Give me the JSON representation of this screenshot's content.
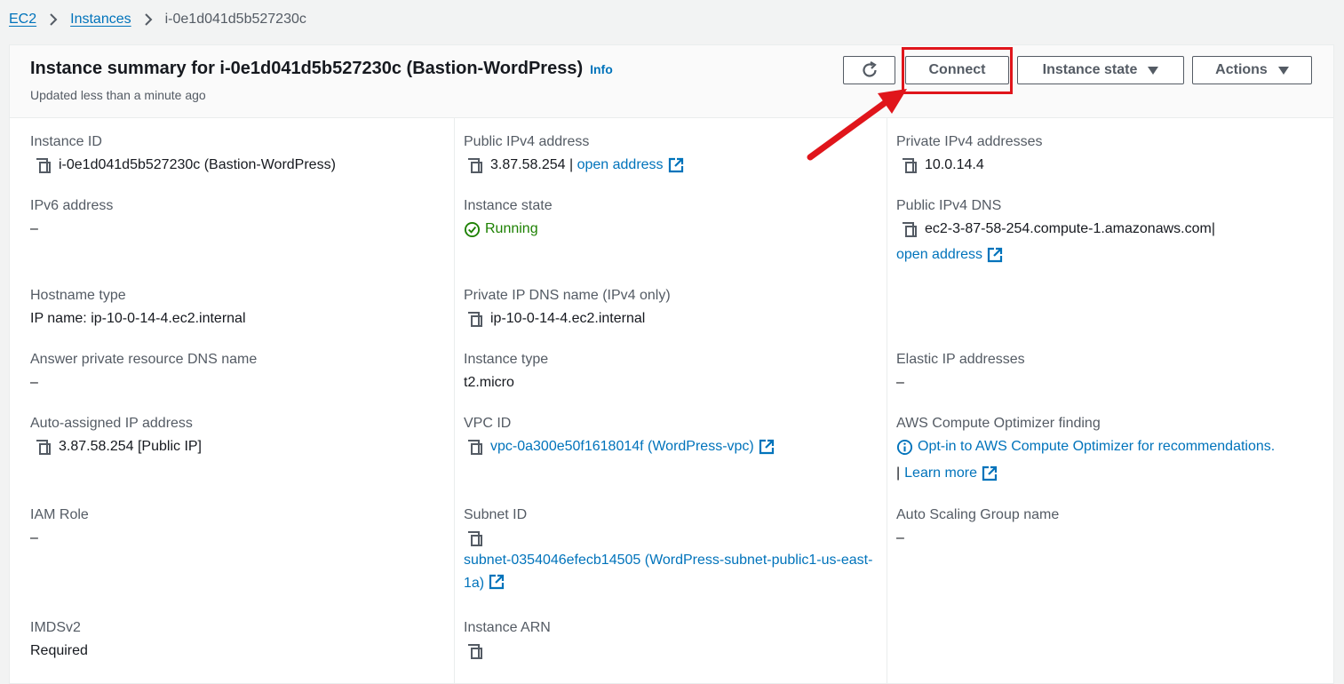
{
  "breadcrumb": {
    "root": "EC2",
    "parent": "Instances",
    "current": "i-0e1d041d5b527230c"
  },
  "header": {
    "title": "Instance summary for i-0e1d041d5b527230c (Bastion-WordPress)",
    "info": "Info",
    "subtitle": "Updated less than a minute ago",
    "connect": "Connect",
    "instance_state": "Instance state",
    "actions": "Actions"
  },
  "fields": {
    "instance_id": {
      "label": "Instance ID",
      "value": "i-0e1d041d5b527230c (Bastion-WordPress)"
    },
    "public_ipv4": {
      "label": "Public IPv4 address",
      "value": "3.87.58.254 |",
      "link": "open address"
    },
    "private_ipv4": {
      "label": "Private IPv4 addresses",
      "value": "10.0.14.4"
    },
    "ipv6": {
      "label": "IPv6 address",
      "value": "–"
    },
    "instance_state": {
      "label": "Instance state",
      "value": "Running"
    },
    "public_dns": {
      "label": "Public IPv4 DNS",
      "value": "ec2-3-87-58-254.compute-1.amazonaws.com|",
      "link": "open address"
    },
    "hostname_type": {
      "label": "Hostname type",
      "value": "IP name: ip-10-0-14-4.ec2.internal"
    },
    "private_dns": {
      "label": "Private IP DNS name (IPv4 only)",
      "value": "ip-10-0-14-4.ec2.internal"
    },
    "answer_dns": {
      "label": "Answer private resource DNS name",
      "value": "–"
    },
    "instance_type": {
      "label": "Instance type",
      "value": "t2.micro"
    },
    "elastic_ip": {
      "label": "Elastic IP addresses",
      "value": "–"
    },
    "auto_ip": {
      "label": "Auto-assigned IP address",
      "value": "3.87.58.254 [Public IP]"
    },
    "vpc_id": {
      "label": "VPC ID",
      "value": "vpc-0a300e50f1618014f (WordPress-vpc)"
    },
    "optimizer": {
      "label": "AWS Compute Optimizer finding",
      "value": "Opt-in to AWS Compute Optimizer for recommendations.",
      "sep": "|",
      "link": "Learn more"
    },
    "iam_role": {
      "label": "IAM Role",
      "value": "–"
    },
    "subnet_id": {
      "label": "Subnet ID",
      "value": "subnet-0354046efecb14505 (WordPress-subnet-public1-us-east-1a)"
    },
    "asg_name": {
      "label": "Auto Scaling Group name",
      "value": "–"
    },
    "imdsv2": {
      "label": "IMDSv2",
      "value": "Required"
    },
    "instance_arn": {
      "label": "Instance ARN"
    }
  },
  "colors": {
    "link": "#0073bb",
    "running": "#1d8102",
    "highlight": "#e0151b"
  }
}
